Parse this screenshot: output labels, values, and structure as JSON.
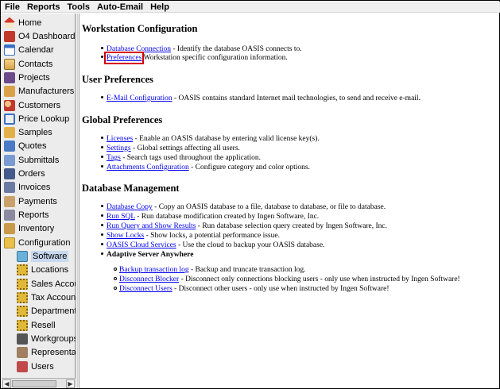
{
  "menu": [
    "File",
    "Reports",
    "Tools",
    "Auto-Email",
    "Help"
  ],
  "sidebar": {
    "items": [
      {
        "label": "Home",
        "icon": "home-icon",
        "cls": "ico-home",
        "level": 0
      },
      {
        "label": "O4 Dashboard",
        "icon": "dashboard-icon",
        "cls": "ico-dash",
        "level": 0
      },
      {
        "label": "Calendar",
        "icon": "calendar-icon",
        "cls": "ico-cal",
        "level": 0
      },
      {
        "label": "Contacts",
        "icon": "contacts-icon",
        "cls": "ico-contact",
        "level": 0
      },
      {
        "label": "Projects",
        "icon": "projects-icon",
        "cls": "ico-proj",
        "level": 0
      },
      {
        "label": "Manufacturers",
        "icon": "manufacturers-icon",
        "cls": "ico-manu",
        "level": 0
      },
      {
        "label": "Customers",
        "icon": "customers-icon",
        "cls": "ico-cust",
        "level": 0
      },
      {
        "label": "Price Lookup",
        "icon": "price-lookup-icon",
        "cls": "ico-price",
        "level": 0
      },
      {
        "label": "Samples",
        "icon": "samples-icon",
        "cls": "ico-samp",
        "level": 0
      },
      {
        "label": "Quotes",
        "icon": "quotes-icon",
        "cls": "ico-quote",
        "level": 0
      },
      {
        "label": "Submittals",
        "icon": "submittals-icon",
        "cls": "ico-submit",
        "level": 0
      },
      {
        "label": "Orders",
        "icon": "orders-icon",
        "cls": "ico-orders",
        "level": 0
      },
      {
        "label": "Invoices",
        "icon": "invoices-icon",
        "cls": "ico-inv",
        "level": 0
      },
      {
        "label": "Payments",
        "icon": "payments-icon",
        "cls": "ico-pay",
        "level": 0
      },
      {
        "label": "Reports",
        "icon": "reports-icon",
        "cls": "ico-rep",
        "level": 0
      },
      {
        "label": "Inventory",
        "icon": "inventory-icon",
        "cls": "ico-inv2",
        "level": 0
      },
      {
        "label": "Configuration",
        "icon": "folder-open-icon",
        "cls": "ico-conf",
        "level": 0
      },
      {
        "label": "Software",
        "icon": "software-icon",
        "cls": "ico-soft",
        "level": 1,
        "selected": true
      },
      {
        "label": "Locations",
        "icon": "gear-icon",
        "cls": "ico-gear",
        "level": 1
      },
      {
        "label": "Sales Accou",
        "icon": "gear-icon",
        "cls": "ico-gear",
        "level": 1
      },
      {
        "label": "Tax Account",
        "icon": "gear-icon",
        "cls": "ico-gear",
        "level": 1
      },
      {
        "label": "Departments",
        "icon": "gear-icon",
        "cls": "ico-gear",
        "level": 1
      },
      {
        "label": "Resell",
        "icon": "gear-icon",
        "cls": "ico-gear",
        "level": 1
      },
      {
        "label": "Workgroups",
        "icon": "workgroups-icon",
        "cls": "ico-workg",
        "level": 1
      },
      {
        "label": "Representat",
        "icon": "representatives-icon",
        "cls": "ico-repr",
        "level": 1
      },
      {
        "label": "Users",
        "icon": "users-icon",
        "cls": "ico-users",
        "level": 1
      }
    ],
    "scroll_left": "◀",
    "scroll_right": "▶"
  },
  "content": {
    "sections": [
      {
        "title": "Workstation Configuration",
        "items": [
          {
            "link": "Database Connection",
            "text": " - Identify the database OASIS connects to."
          },
          {
            "link": "Preferences",
            "text": " Workstation specific configuration information.",
            "highlight": true
          }
        ]
      },
      {
        "title": "User Preferences",
        "items": [
          {
            "link": "E-Mail Configuration",
            "text": " - OASIS contains standard Internet mail technologies, to send and receive e-mail."
          }
        ]
      },
      {
        "title": "Global Preferences",
        "items": [
          {
            "link": "Licenses",
            "text": " - Enable an OASIS database by entering valid license key(s)."
          },
          {
            "link": "Settings",
            "text": " - Global settings affecting all users."
          },
          {
            "link": "Tags",
            "text": " - Search tags used throughout the application."
          },
          {
            "link": "Attachments Configuration",
            "text": " - Configure category and color options."
          }
        ]
      },
      {
        "title": "Database Management",
        "items": [
          {
            "link": "Database Copy",
            "text": " - Copy an OASIS database to a file, database to database, or file to database."
          },
          {
            "link": "Run SQL",
            "text": " - Run database modification created by Ingen Software, Inc."
          },
          {
            "link": "Run Query and Show Results",
            "text": " - Run database selection query created by Ingen Software, Inc."
          },
          {
            "link": "Show Locks",
            "text": " - Show locks, a potential performance issue."
          },
          {
            "link": "OASIS Cloud Services",
            "text": " - Use the cloud to backup your OASIS database."
          },
          {
            "bold": "Adaptive Server Anywhere"
          }
        ],
        "subitems": [
          {
            "link": "Backup transaction log",
            "text": " - Backup and truncate transaction log."
          },
          {
            "link": "Disconnect Blocker",
            "text": " - Disconnect only connections blocking users - only use when instructed by Ingen Software!"
          },
          {
            "link": "Disconnect Users",
            "text": " - Disconnect other users - only use when instructed by Ingen Software!"
          }
        ]
      }
    ]
  },
  "colors": {
    "link": "#0000ee",
    "highlight": "#d40000",
    "selected_bg": "#c8d8ef"
  }
}
